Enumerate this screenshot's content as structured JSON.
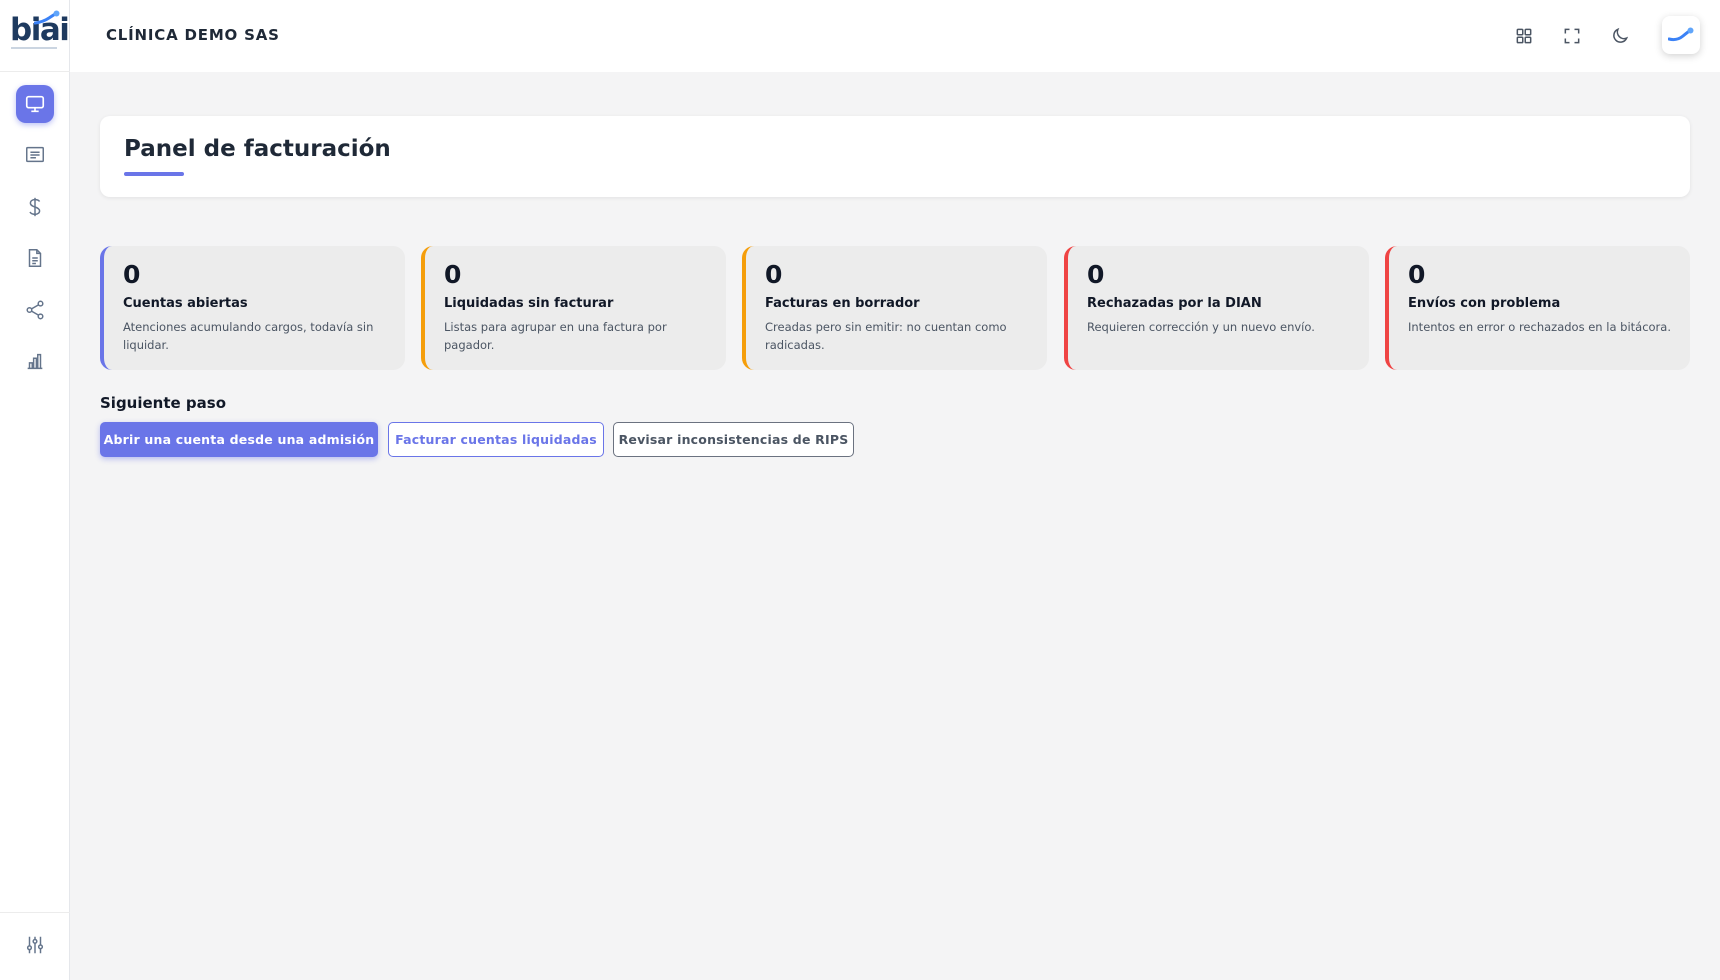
{
  "logo": {
    "text": "biai"
  },
  "header": {
    "company": "CLÍNICA DEMO SAS"
  },
  "sidebar": {
    "items": [
      {
        "name": "monitor-icon",
        "active": true
      },
      {
        "name": "receipt-icon",
        "active": false
      },
      {
        "name": "dollar-icon",
        "active": false
      },
      {
        "name": "document-icon",
        "active": false
      },
      {
        "name": "share-icon",
        "active": false
      },
      {
        "name": "bar-chart-icon",
        "active": false
      }
    ],
    "bottom_icon": "sliders-icon"
  },
  "toolbar_icons": [
    "grid-icon",
    "fullscreen-icon",
    "moon-icon"
  ],
  "page": {
    "title": "Panel de facturación"
  },
  "stats": [
    {
      "value": "0",
      "label": "Cuentas abiertas",
      "desc": "Atenciones acumulando cargos, todavía sin liquidar.",
      "color": "#6a75e8"
    },
    {
      "value": "0",
      "label": "Liquidadas sin facturar",
      "desc": "Listas para agrupar en una factura por pagador.",
      "color": "#f59e0b"
    },
    {
      "value": "0",
      "label": "Facturas en borrador",
      "desc": "Creadas pero sin emitir: no cuentan como radicadas.",
      "color": "#f59e0b"
    },
    {
      "value": "0",
      "label": "Rechazadas por la DIAN",
      "desc": "Requieren corrección y un nuevo envío.",
      "color": "#ef4444"
    },
    {
      "value": "0",
      "label": "Envíos con problema",
      "desc": "Intentos en error o rechazados en la bitácora.",
      "color": "#ef4444"
    }
  ],
  "next_step": {
    "title": "Siguiente paso",
    "buttons": [
      "Abrir una cuenta desde una admisión",
      "Facturar cuentas liquidadas",
      "Revisar inconsistencias de RIPS"
    ]
  },
  "colors": {
    "accent": "#6a75e8",
    "warning": "#f59e0b",
    "danger": "#ef4444"
  }
}
